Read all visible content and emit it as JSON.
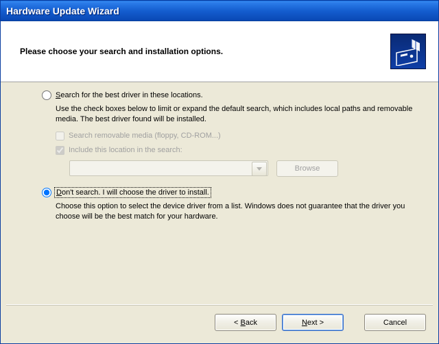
{
  "window": {
    "title": "Hardware Update Wizard"
  },
  "header": {
    "title": "Please choose your search and installation options."
  },
  "options": {
    "search": {
      "label_pre": "S",
      "label_rest": "earch for the best driver in these locations.",
      "description": "Use the check boxes below to limit or expand the default search, which includes local paths and removable media. The best driver found will be installed.",
      "chk_media": "Search removable media (floppy, CD-ROM...)",
      "chk_include": "Include this location in the search:",
      "path": "",
      "browse": "Browse"
    },
    "dont_search": {
      "label_pre": "D",
      "label_rest": "on't search. I will choose the driver to install.",
      "description": "Choose this option to select the device driver from a list.  Windows does not guarantee that the driver you choose will be the best match for your hardware."
    }
  },
  "buttons": {
    "back_pre": "< ",
    "back_u": "B",
    "back_rest": "ack",
    "next_pre": "",
    "next_u": "N",
    "next_rest": "ext >",
    "cancel": "Cancel"
  }
}
